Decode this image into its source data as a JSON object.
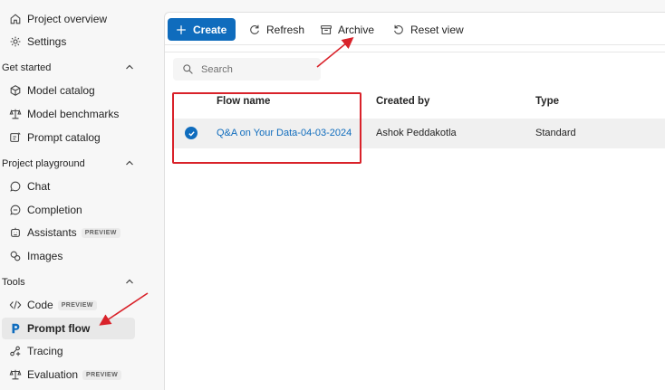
{
  "sidebar": {
    "top_items": [
      {
        "label": "Project overview",
        "icon": "home-icon"
      },
      {
        "label": "Settings",
        "icon": "gear-icon"
      }
    ],
    "sections": [
      {
        "title": "Get started",
        "items": [
          {
            "label": "Model catalog",
            "icon": "cube-icon"
          },
          {
            "label": "Model benchmarks",
            "icon": "scales-icon"
          },
          {
            "label": "Prompt catalog",
            "icon": "prompt-icon"
          }
        ]
      },
      {
        "title": "Project playground",
        "items": [
          {
            "label": "Chat",
            "icon": "chat-icon"
          },
          {
            "label": "Completion",
            "icon": "completion-icon"
          },
          {
            "label": "Assistants",
            "icon": "assistant-icon",
            "badge": "PREVIEW"
          },
          {
            "label": "Images",
            "icon": "images-icon"
          }
        ]
      },
      {
        "title": "Tools",
        "items": [
          {
            "label": "Code",
            "icon": "code-icon",
            "badge": "PREVIEW"
          },
          {
            "label": "Prompt flow",
            "icon": "prompt-flow-icon",
            "selected": true
          },
          {
            "label": "Tracing",
            "icon": "tracing-icon"
          },
          {
            "label": "Evaluation",
            "icon": "evaluation-icon",
            "badge": "PREVIEW"
          }
        ]
      }
    ]
  },
  "toolbar": {
    "create_label": "Create",
    "refresh_label": "Refresh",
    "archive_label": "Archive",
    "reset_label": "Reset view"
  },
  "search": {
    "placeholder": "Search"
  },
  "table": {
    "columns": [
      "Flow name",
      "Created by",
      "Type"
    ],
    "rows": [
      {
        "flow_name": "Q&A on Your Data-04-03-2024",
        "created_by": "Ashok Peddakotla",
        "type": "Standard",
        "selected": true
      }
    ]
  },
  "colors": {
    "accent": "#0f6cbd",
    "annotation": "#d9222a"
  }
}
